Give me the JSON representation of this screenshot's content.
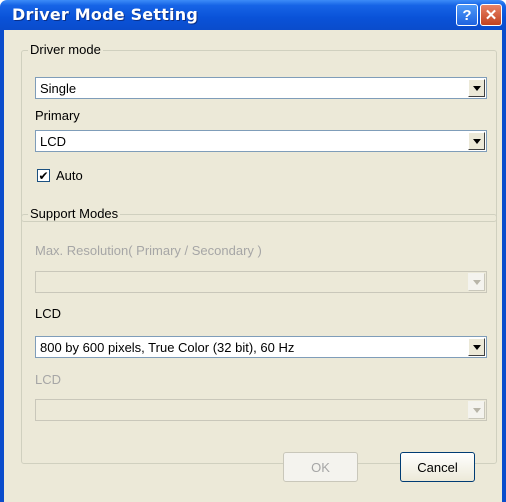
{
  "window": {
    "title": "Driver Mode Setting",
    "help_glyph": "?",
    "close_glyph": "✕"
  },
  "driver_mode": {
    "legend": "Driver mode",
    "mode_value": "Single",
    "primary_label": "Primary",
    "primary_value": "LCD",
    "auto_label": "Auto",
    "auto_checked": true,
    "check_glyph": "✔"
  },
  "support_modes": {
    "legend": "Support Modes",
    "max_resolution_label": "Max. Resolution( Primary / Secondary )",
    "max_resolution_value": "",
    "lcd_label": "LCD",
    "lcd_value": "800 by 600 pixels, True Color (32 bit), 60 Hz",
    "lcd2_label": "LCD",
    "lcd2_value": ""
  },
  "buttons": {
    "ok": "OK",
    "cancel": "Cancel"
  },
  "colors": {
    "title_bar": "#0a4ccc",
    "client_bg": "#ece9d8",
    "combo_border": "#7f9db9",
    "disabled_text": "#a6a6a6"
  }
}
